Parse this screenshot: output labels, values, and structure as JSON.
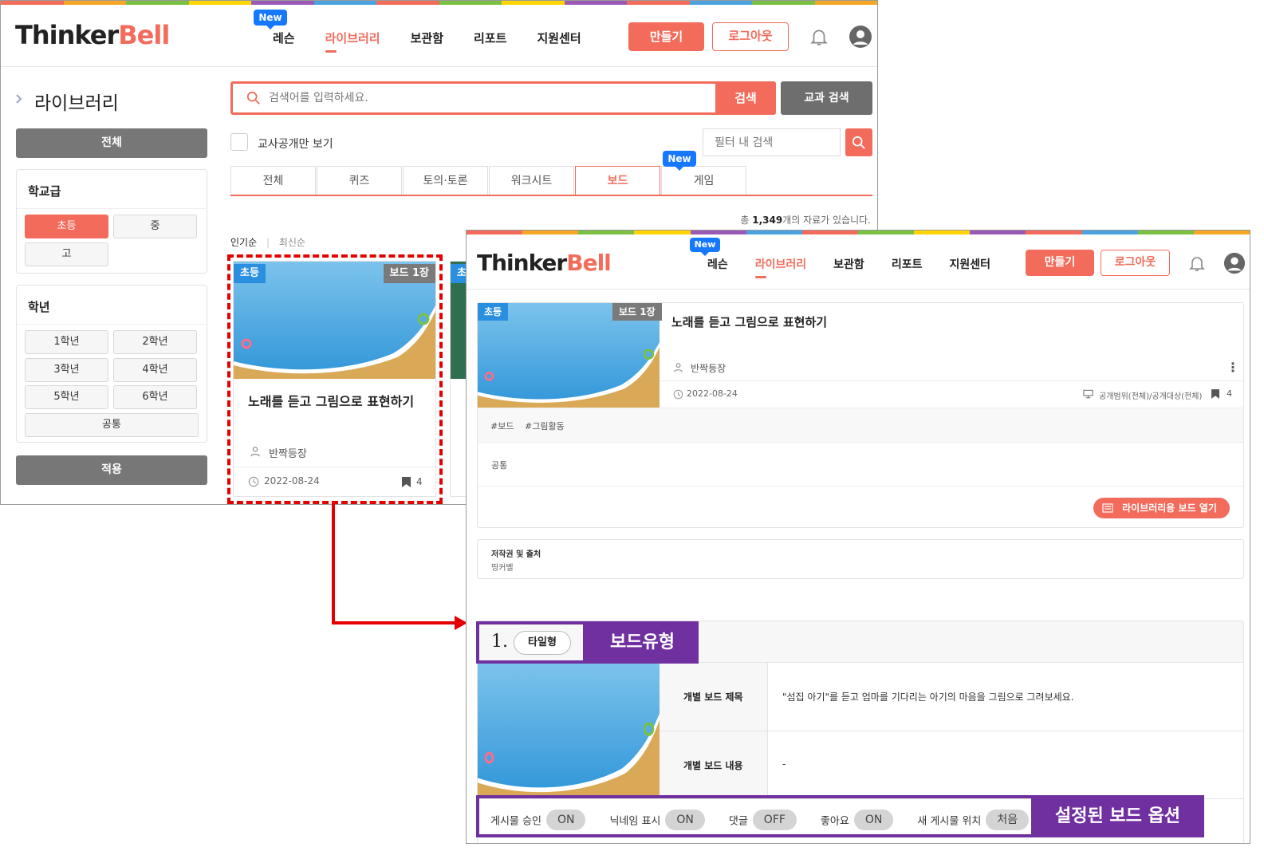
{
  "colors": {
    "accent": "#f26b5b",
    "gray_button": "#777777",
    "new_badge": "#1677ff",
    "annotation_purple": "#7030a0",
    "highlight_red": "#e40000"
  },
  "rainbow": [
    "#f26b5b",
    "#f5a623",
    "#7ac143",
    "#ffd400",
    "#9b59b6",
    "#4aa3df",
    "#f26b5b",
    "#7ac143",
    "#ffd400",
    "#9b59b6",
    "#f26b5b",
    "#4aa3df",
    "#7ac143",
    "#f5a623"
  ],
  "header": {
    "logo_part1": "Thinker",
    "logo_part2": "Bell",
    "new_badge": "New",
    "nav": [
      "레슨",
      "라이브러리",
      "보관함",
      "리포트",
      "지원센터"
    ],
    "active_nav": "라이브러리",
    "create_label": "만들기",
    "logout_label": "로그아웃",
    "bell_icon": "bell-icon",
    "profile_icon": "user-icon"
  },
  "sidebar": {
    "title": "라이브러리",
    "all_label": "전체",
    "school_title": "학교급",
    "school_levels": [
      "초등",
      "중",
      "고"
    ],
    "selected_school": "초등",
    "grade_title": "학년",
    "grades": [
      "1학년",
      "2학년",
      "3학년",
      "4학년",
      "5학년",
      "6학년",
      "공통"
    ],
    "apply_label": "적용"
  },
  "search": {
    "placeholder": "검색어를 입력하세요.",
    "search_label": "검색",
    "subject_search_label": "교과 검색",
    "teacher_only_label": "교사공개만 보기",
    "filter_placeholder": "필터 내 검색"
  },
  "tabs": {
    "items": [
      "전체",
      "퀴즈",
      "토의·토론",
      "워크시트",
      "보드",
      "게임"
    ],
    "active": "보드",
    "new_on": "게임",
    "new_badge": "New"
  },
  "results": {
    "prefix": "총 ",
    "count": "1,349",
    "suffix": "개의 자료가 있습니다."
  },
  "sort": {
    "popular": "인기순",
    "latest": "최신순"
  },
  "card": {
    "level_tag": "초등",
    "type_tag": "보드 1장",
    "title": "노래를 듣고 그림으로 표현하기",
    "author": "반짝등장",
    "date": "2022-08-24",
    "bookmarks": "4",
    "next_card_tag": "초"
  },
  "detail": {
    "level_tag": "초등",
    "type_tag": "보드 1장",
    "title": "노래를 듣고 그림으로 표현하기",
    "author": "반짝등장",
    "date": "2022-08-24",
    "visibility": "공개범위(전체)/공개대상(전체)",
    "bookmarks": "4",
    "hashtags": [
      "#보드",
      "#그림활동"
    ],
    "grade": "공통",
    "open_board_label": "라이브러리용 보드 열기",
    "copyright_title": "저작권 및 출처",
    "copyright_value": "띵커벨",
    "board_index": "1.",
    "board_type": "타일형",
    "board_title_label": "개별 보드 제목",
    "board_title_value": "\"섬집 아기\"를 듣고 엄마를 기다리는 아기의 마음을 그림으로 그려보세요.",
    "board_content_label": "개별 보드 내용",
    "board_content_value": "-",
    "options": [
      {
        "label": "게시물 승인",
        "value": "ON"
      },
      {
        "label": "닉네임 표시",
        "value": "ON"
      },
      {
        "label": "댓글",
        "value": "OFF"
      },
      {
        "label": "좋아요",
        "value": "ON"
      },
      {
        "label": "새 게시물 위치",
        "value": "처음"
      }
    ]
  },
  "annotations": {
    "board_type": "보드유형",
    "board_options": "설정된 보드 옵션"
  }
}
